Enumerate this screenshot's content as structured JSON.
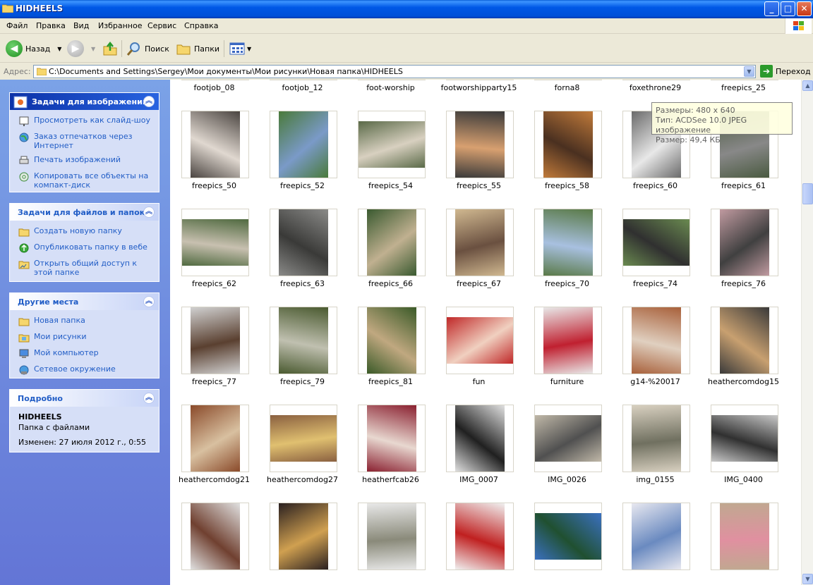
{
  "window": {
    "title": "HIDHEELS",
    "buttons": {
      "minimize": "_",
      "maximize": "□",
      "close": "✕"
    }
  },
  "menu": [
    "Файл",
    "Правка",
    "Вид",
    "Избранное",
    "Сервис",
    "Справка"
  ],
  "toolbar": {
    "back": "Назад",
    "search": "Поиск",
    "folders": "Папки"
  },
  "address": {
    "label": "Адрес:",
    "path": "C:\\Documents and Settings\\Sergey\\Мои документы\\Мои рисунки\\Новая папка\\HIDHEELS",
    "go": "Переход"
  },
  "sidebar": {
    "image_tasks": {
      "title": "Задачи для изображений",
      "items": [
        "Просмотреть как слайд-шоу",
        "Заказ отпечатков через Интернет",
        "Печать изображений",
        "Копировать все объекты на компакт-диск"
      ]
    },
    "file_tasks": {
      "title": "Задачи для файлов и папок",
      "items": [
        "Создать новую папку",
        "Опубликовать папку в вебе",
        "Открыть общий доступ к этой папке"
      ]
    },
    "other_places": {
      "title": "Другие места",
      "items": [
        "Новая папка",
        "Мои рисунки",
        "Мой компьютер",
        "Сетевое окружение"
      ]
    },
    "details": {
      "title": "Подробно",
      "name": "HIDHEELS",
      "type": "Папка с файлами",
      "modified": "Изменен: 27 июля 2012 г., 0:55"
    }
  },
  "files": [
    "footjob_08",
    "footjob_12",
    "foot-worship",
    "footworshipparty15",
    "forna8",
    "foxethrone29",
    "freepics_25",
    "freepics_50",
    "freepics_52",
    "freepics_54",
    "freepics_55",
    "freepics_58",
    "freepics_60",
    "freepics_61",
    "freepics_62",
    "freepics_63",
    "freepics_66",
    "freepics_67",
    "freepics_70",
    "freepics_74",
    "freepics_76",
    "freepics_77",
    "freepics_79",
    "freepics_81",
    "fun",
    "furniture",
    "g14-%20017",
    "heathercomdog15",
    "heathercomdog21",
    "heathercomdog27",
    "heatherfcab26",
    "IMG_0007",
    "IMG_0026",
    "img_0155",
    "IMG_0400",
    "",
    "",
    "",
    "",
    "",
    "",
    ""
  ],
  "tooltip": {
    "size": "Размеры: 480 x 640",
    "type": "Тип: ACDSee 10.0 JPEG изображение",
    "filesize": "Размер: 49,4 КБ"
  },
  "colors": {
    "titlebar": "#0058e6",
    "sidebar": "#6375d6",
    "link": "#215dc6"
  }
}
